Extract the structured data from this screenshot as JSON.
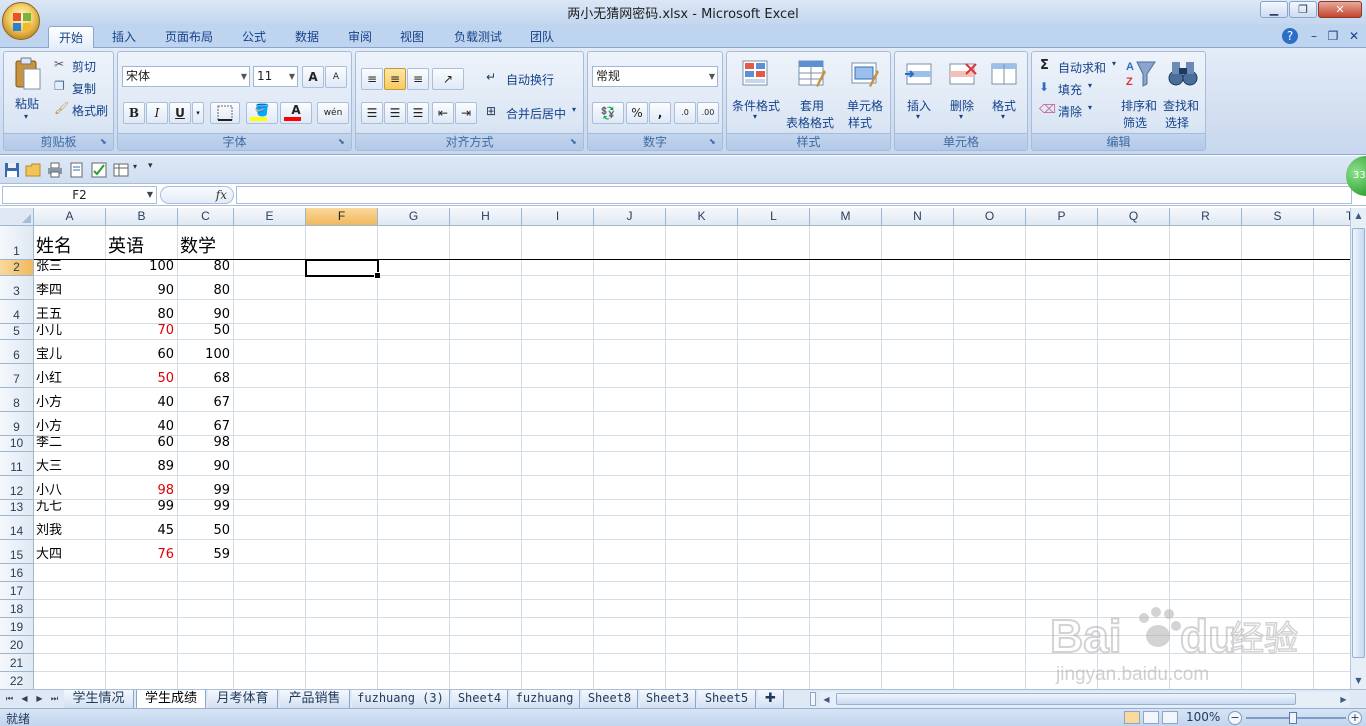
{
  "window": {
    "title": "两小无猜网密码.xlsx - Microsoft Excel",
    "min_label": "▁",
    "max_label": "❐",
    "close_label": "✕"
  },
  "ribbon_tabs": [
    "开始",
    "插入",
    "页面布局",
    "公式",
    "数据",
    "审阅",
    "视图",
    "负载测试",
    "团队"
  ],
  "ribbon_right": {
    "help": "?",
    "min": "–",
    "restore": "❐",
    "close": "✕"
  },
  "groups": {
    "clipboard": {
      "label": "剪贴板",
      "paste": "粘贴",
      "cut": "剪切",
      "copy": "复制",
      "format_painter": "格式刷"
    },
    "font": {
      "label": "字体",
      "font_name": "宋体",
      "font_size": "11",
      "bold": "B",
      "italic": "I",
      "underline": "U",
      "grow": "A",
      "shrink": "A",
      "font_color": "A",
      "phonetic": "wén"
    },
    "alignment": {
      "label": "对齐方式",
      "wrap": "自动换行",
      "merge": "合并后居中"
    },
    "number": {
      "label": "数字",
      "format": "常规",
      "percent": "%",
      "comma": ","
    },
    "styles": {
      "label": "样式",
      "conditional": "条件格式",
      "table_1": "套用",
      "table_2": "表格格式",
      "cell_1": "单元格",
      "cell_2": "样式"
    },
    "cells": {
      "label": "单元格",
      "insert": "插入",
      "delete": "删除",
      "format": "格式"
    },
    "editing": {
      "label": "编辑",
      "autosum": "自动求和",
      "fill": "填充",
      "clear": "清除",
      "sort_1": "排序和",
      "sort_2": "筛选",
      "find_1": "查找和",
      "find_2": "选择"
    }
  },
  "formula_bar": {
    "name_box": "F2",
    "fx": "fx",
    "formula": ""
  },
  "badge": "33",
  "columns": [
    "A",
    "B",
    "C",
    "E",
    "F",
    "G",
    "H",
    "I",
    "J",
    "K",
    "L",
    "M",
    "N",
    "O",
    "P",
    "Q",
    "R",
    "S",
    "T"
  ],
  "selected_column": "F",
  "rows": [
    {
      "num": "1",
      "a": "姓名",
      "b": "英语",
      "c": "数学",
      "b_red": false
    },
    {
      "num": "2",
      "a": "张三",
      "b": "100",
      "c": "80",
      "b_red": false
    },
    {
      "num": "3",
      "a": "李四",
      "b": "90",
      "c": "80",
      "b_red": false
    },
    {
      "num": "4",
      "a": "王五",
      "b": "80",
      "c": "90",
      "b_red": false
    },
    {
      "num": "5",
      "a": "小儿",
      "b": "70",
      "c": "50",
      "b_red": true
    },
    {
      "num": "6",
      "a": "宝儿",
      "b": "60",
      "c": "100",
      "b_red": false
    },
    {
      "num": "7",
      "a": "小红",
      "b": "50",
      "c": "68",
      "b_red": true
    },
    {
      "num": "8",
      "a": "小方",
      "b": "40",
      "c": "67",
      "b_red": false
    },
    {
      "num": "9",
      "a": "小方",
      "b": "40",
      "c": "67",
      "b_red": false
    },
    {
      "num": "10",
      "a": "李二",
      "b": "60",
      "c": "98",
      "b_red": false
    },
    {
      "num": "11",
      "a": "大三",
      "b": "89",
      "c": "90",
      "b_red": false
    },
    {
      "num": "12",
      "a": "小八",
      "b": "98",
      "c": "99",
      "b_red": true
    },
    {
      "num": "13",
      "a": "九七",
      "b": "99",
      "c": "99",
      "b_red": false
    },
    {
      "num": "14",
      "a": "刘我",
      "b": "45",
      "c": "50",
      "b_red": false
    },
    {
      "num": "15",
      "a": "大四",
      "b": "76",
      "c": "59",
      "b_red": true
    },
    {
      "num": "16",
      "a": "",
      "b": "",
      "c": "",
      "b_red": false
    },
    {
      "num": "17",
      "a": "",
      "b": "",
      "c": "",
      "b_red": false
    },
    {
      "num": "18",
      "a": "",
      "b": "",
      "c": "",
      "b_red": false
    },
    {
      "num": "19",
      "a": "",
      "b": "",
      "c": "",
      "b_red": false
    },
    {
      "num": "20",
      "a": "",
      "b": "",
      "c": "",
      "b_red": false
    },
    {
      "num": "21",
      "a": "",
      "b": "",
      "c": "",
      "b_red": false
    },
    {
      "num": "22",
      "a": "",
      "b": "",
      "c": "",
      "b_red": false
    }
  ],
  "sheet_tabs": [
    "学生情况",
    "学生成绩",
    "月考体育",
    "产品销售",
    "fuzhuang (3)",
    "Sheet4",
    "fuzhuang",
    "Sheet8",
    "Sheet3",
    "Sheet5"
  ],
  "active_sheet": "学生成绩",
  "status": {
    "text": "就绪",
    "zoom": "100%"
  },
  "colors": {
    "red_value": "#e00000",
    "accent": "#15428b",
    "selection": "#f1b85c"
  },
  "watermark": {
    "brand_1": "Bai",
    "brand_2": "du",
    "brand_3": "经验",
    "url": "jingyan.baidu.com"
  }
}
